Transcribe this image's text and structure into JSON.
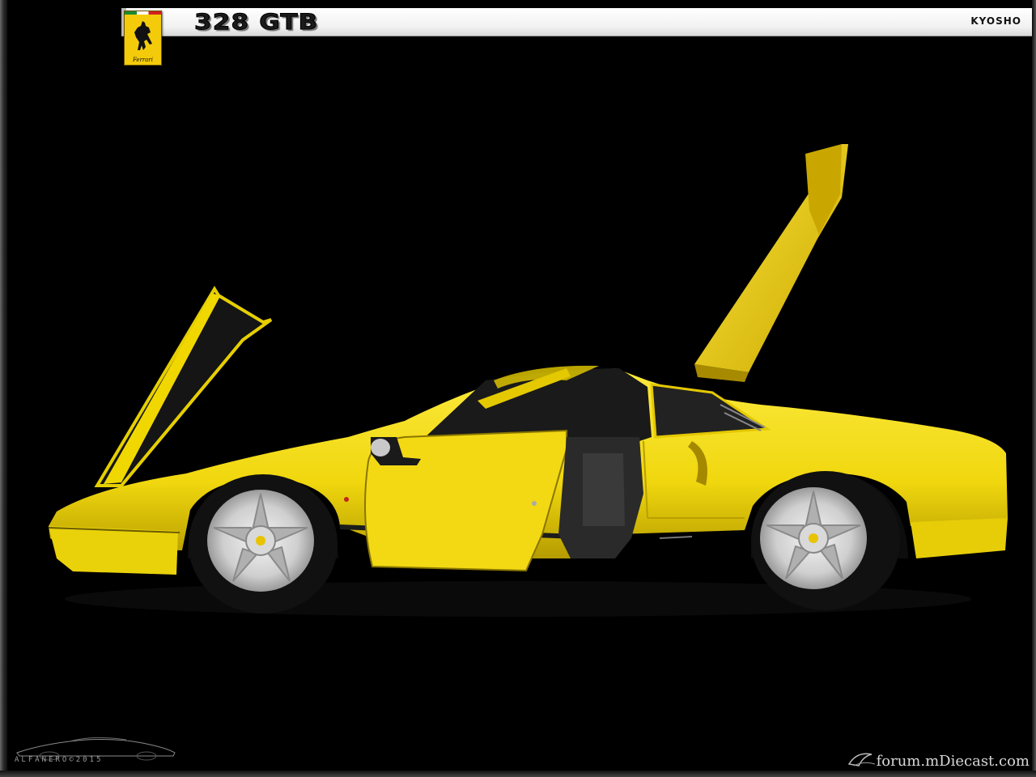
{
  "header": {
    "title": "328 GTB",
    "brand": "KYOSHO",
    "badge_text": "Ferrari"
  },
  "watermarks": {
    "left": "ALFANERO©2015",
    "right": "forum.mDiecast.com"
  },
  "colors": {
    "car_yellow": "#f3dc12",
    "background": "#000000",
    "badge_yellow": "#f4cb0a"
  },
  "icons": {
    "badge": "prancing-horse-icon"
  }
}
